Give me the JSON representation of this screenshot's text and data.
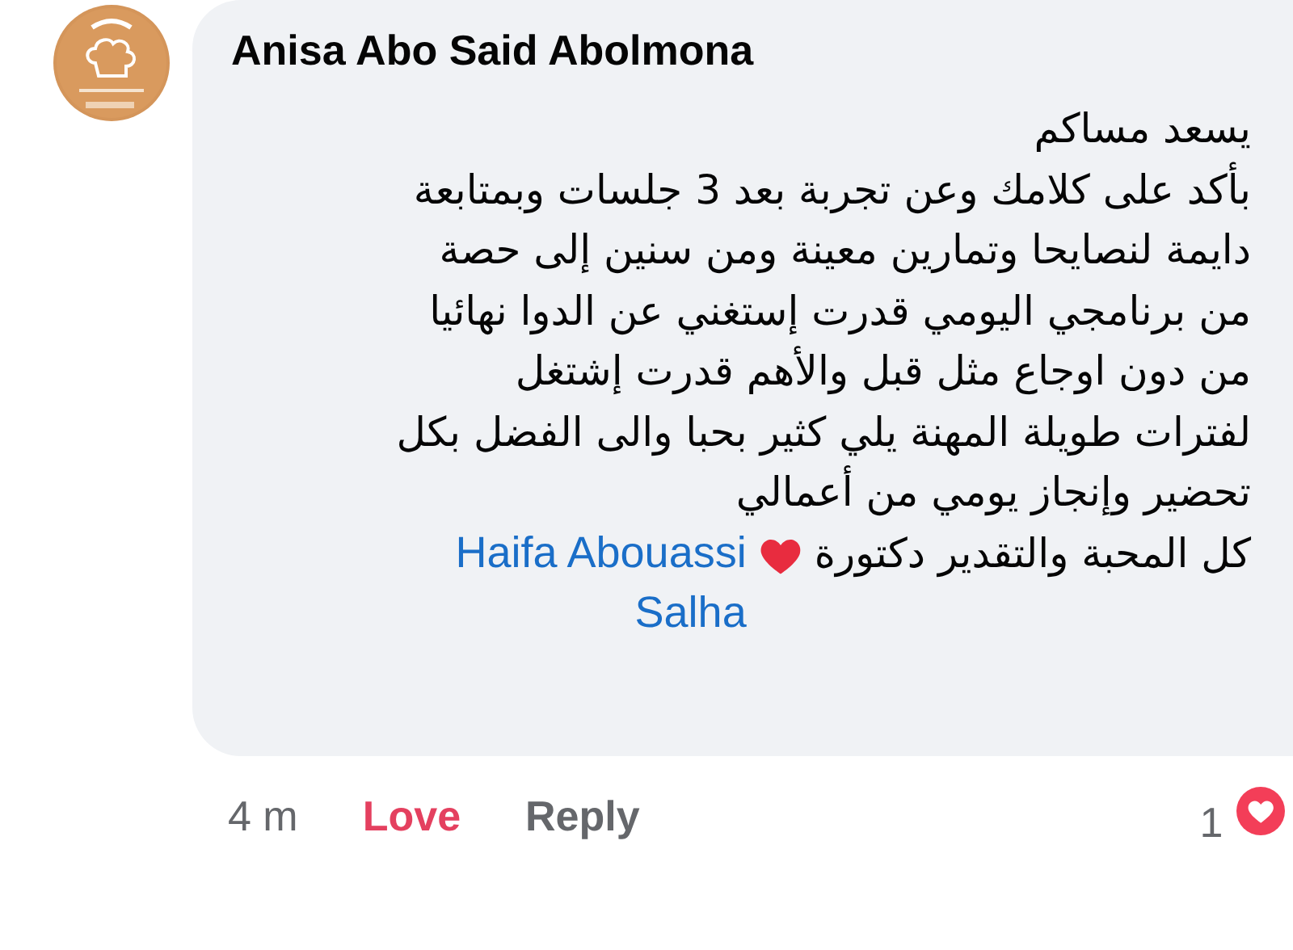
{
  "comment": {
    "author": "Anisa Abo Said Abolmona",
    "lines": [
      "يسعد مساكم",
      "بأكد على كلامك وعن تجربة بعد 3 جلسات وبمتابعة",
      "دايمة لنصايحا وتمارين معينة  ومن سنين إلى حصة",
      "من برنامجي اليومي قدرت إستغني عن الدوا نهائيا",
      "من دون اوجاع مثل قبل والأهم قدرت إشتغل",
      "لفترات طويلة المهنة يلي كثير بحبا والى الفضل بكل",
      "تحضير وإنجاز يومي من أعمالي"
    ],
    "closing": "كل المحبة والتقدير دكتورة",
    "mention": "Haifa Abouassi Salha"
  },
  "actions": {
    "time": "4 m",
    "love": {
      "label": "Love",
      "liked": true
    },
    "reply": "Reply"
  },
  "reactions": {
    "count": "1"
  }
}
